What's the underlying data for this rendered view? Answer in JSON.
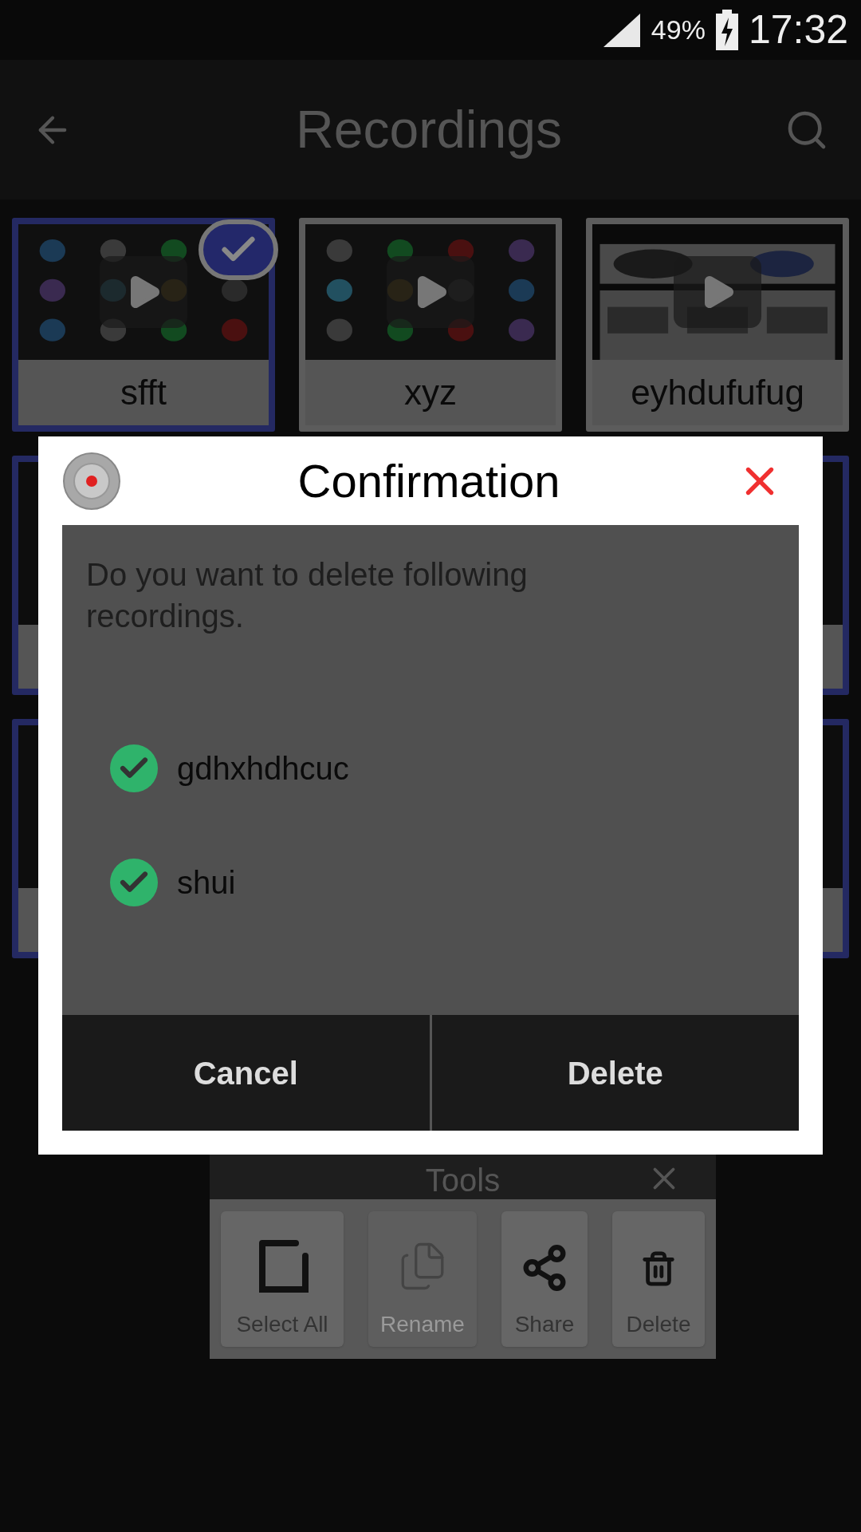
{
  "status_bar": {
    "battery": "49%",
    "time": "17:32"
  },
  "app_bar": {
    "title": "Recordings"
  },
  "cards": [
    {
      "name": "sfft",
      "selected": true
    },
    {
      "name": "xyz",
      "selected": false
    },
    {
      "name": "eyhdufufug",
      "selected": false
    }
  ],
  "hidden_rows": [
    [
      {
        "selected": true
      },
      {
        "selected": true
      }
    ],
    [
      {
        "selected": true
      },
      {
        "selected": true
      }
    ]
  ],
  "tools": {
    "title": "Tools",
    "buttons": [
      {
        "kind": "select",
        "label": "Select All",
        "disabled": false
      },
      {
        "kind": "rename",
        "label": "Rename",
        "disabled": true
      },
      {
        "kind": "share",
        "label": "Share",
        "disabled": false
      },
      {
        "kind": "delete",
        "label": "Delete",
        "disabled": false
      }
    ]
  },
  "dialog": {
    "title": "Confirmation",
    "message": "Do you want to delete following recordings.",
    "items": [
      {
        "name": "gdhxhdhcuc",
        "checked": true
      },
      {
        "name": "shui",
        "checked": true
      }
    ],
    "buttons": [
      "Cancel",
      "Delete"
    ]
  }
}
